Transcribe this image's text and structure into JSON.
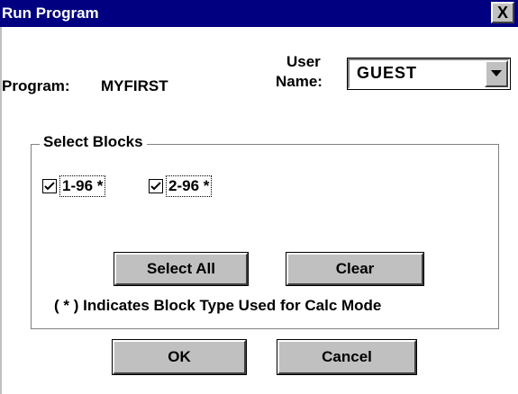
{
  "window": {
    "title": "Run Program",
    "close_glyph": "X"
  },
  "program": {
    "label": "Program:",
    "value": "MYFIRST"
  },
  "user": {
    "label_line1": "User",
    "label_line2": "Name:",
    "selected": "GUEST"
  },
  "blocks": {
    "legend": "Select Blocks",
    "items": [
      {
        "label": "1-96 *",
        "checked": true
      },
      {
        "label": "2-96 *",
        "checked": true
      }
    ],
    "select_all_label": "Select All",
    "clear_label": "Clear",
    "footnote": "( * )  Indicates Block Type Used for Calc Mode"
  },
  "actions": {
    "ok_label": "OK",
    "cancel_label": "Cancel"
  },
  "colors": {
    "titlebar": "#000080",
    "button_face": "#c0c0c0"
  },
  "icons": {
    "close": "close-icon",
    "dropdown": "chevron-down-icon",
    "check": "check-icon"
  }
}
